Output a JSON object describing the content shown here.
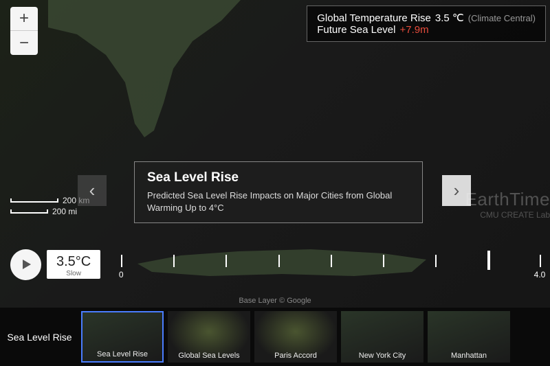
{
  "info": {
    "temp_label": "Global Temperature Rise",
    "temp_value": "3.5 ℃",
    "source": "(Climate Central)",
    "sea_label": "Future Sea Level",
    "sea_value": "+7.9m"
  },
  "scale": {
    "km": "200 km",
    "mi": "200 mi"
  },
  "overlay": {
    "title": "Sea Level Rise",
    "desc": "Predicted Sea Level Rise Impacts on Major Cities from Global Warming Up to 4°C"
  },
  "branding": {
    "title": "EarthTime",
    "sub": "CMU CREATE Lab"
  },
  "timeline": {
    "current_temp": "3.5°C",
    "speed": "Slow",
    "start": "0",
    "end": "4.0",
    "current_pct": 87.5
  },
  "attribution": "Base Layer © Google",
  "thumbs": {
    "section_label": "Sea Level Rise",
    "items": [
      "Sea Level Rise",
      "Global Sea Levels",
      "Paris Accord",
      "New York City",
      "Manhattan"
    ]
  }
}
